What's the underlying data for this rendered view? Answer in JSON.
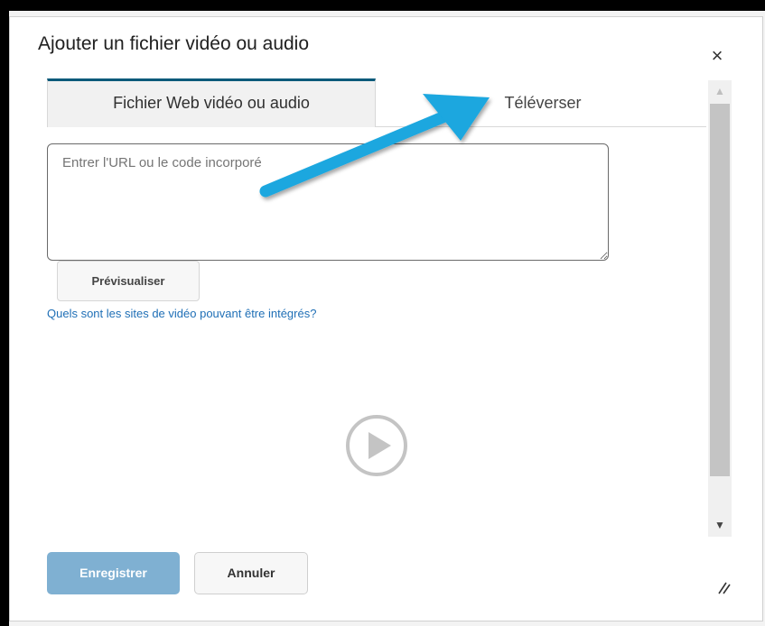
{
  "dialog": {
    "title": "Ajouter un fichier vidéo ou audio",
    "close_symbol": "×"
  },
  "tabs": [
    {
      "label": "Fichier Web vidéo ou audio",
      "active": true
    },
    {
      "label": "Téléverser",
      "active": false
    }
  ],
  "url_input": {
    "placeholder": "Entrer l'URL ou le code incorporé",
    "value": ""
  },
  "preview_button": {
    "label": "Prévisualiser"
  },
  "help_link": {
    "label": "Quels sont les sites de vidéo pouvant être intégrés?"
  },
  "footer": {
    "save_label": "Enregistrer",
    "cancel_label": "Annuler"
  },
  "scrollbar": {
    "up_symbol": "▲",
    "down_symbol": "▼"
  },
  "icons": {
    "close": "close-icon",
    "play": "play-circle-icon",
    "resize": "resize-grip-icon",
    "annotation_arrow": "arrow-icon"
  },
  "colors": {
    "accent_tab": "#0a5a7a",
    "save_button": "#7fb0d2",
    "link": "#1f6fb6",
    "annotation_arrow": "#1aa7df"
  }
}
